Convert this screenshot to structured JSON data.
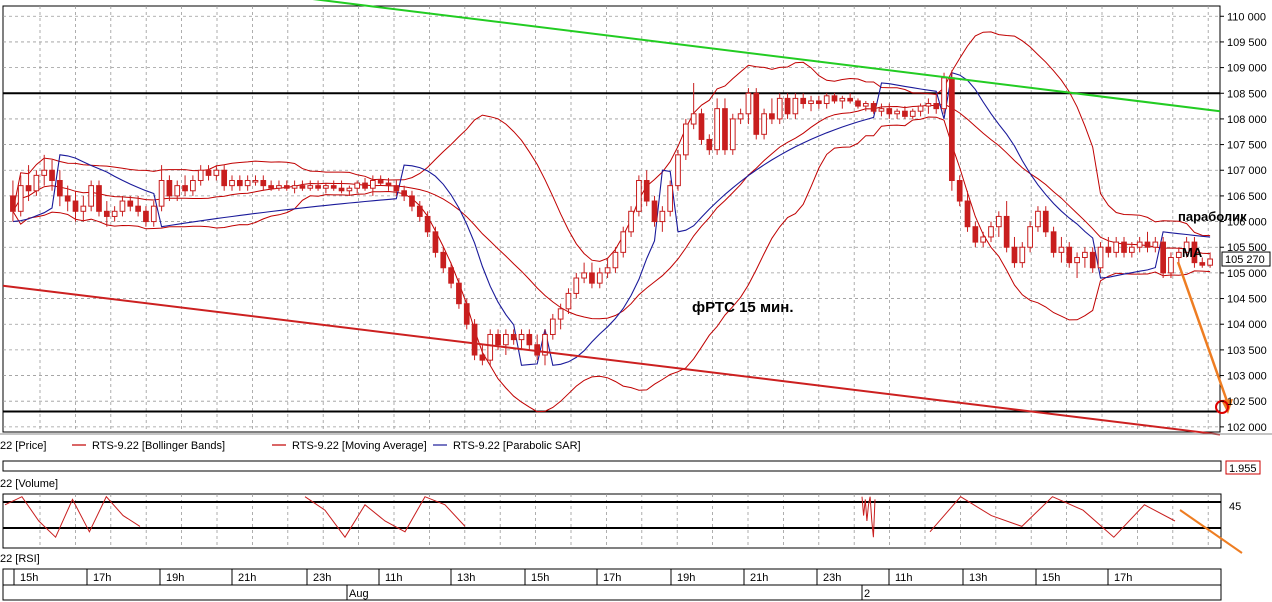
{
  "chart_data": {
    "type": "candlestick",
    "title": "фРТС   15 мин.",
    "price_axis": {
      "ylim": [
        101900,
        110200
      ],
      "ticks": [
        "110 000",
        "109 500",
        "109 000",
        "108 500",
        "108 000",
        "107 500",
        "107 000",
        "106 500",
        "106 000",
        "105 500",
        "105 000",
        "104 500",
        "104 000",
        "103 500",
        "103 000",
        "102 500",
        "102 000"
      ],
      "tick_values": [
        110000,
        109500,
        109000,
        108500,
        108000,
        107500,
        107000,
        106500,
        106000,
        105500,
        105000,
        104500,
        104000,
        103500,
        103000,
        102500,
        102000
      ],
      "last_price_label": "105 270",
      "last_price": 105270
    },
    "legend": [
      {
        "text": "22 [Price]",
        "color": "#000000"
      },
      {
        "text": "RTS-9.22 [Bollinger Bands]",
        "color": "#c00000"
      },
      {
        "text": "RTS-9.22 [Moving Average]",
        "color": "#c00000"
      },
      {
        "text": "RTS-9.22 [Parabolic SAR]",
        "color": "#1a1a9a"
      }
    ],
    "volume_panel": {
      "label": "22 [Volume]",
      "value_label": "1.955"
    },
    "rsi_panel": {
      "label": "22 [RSI]",
      "level_label": "45"
    },
    "time_axis": {
      "ticks": [
        "15h",
        "17h",
        "19h",
        "21h",
        "23h",
        "11h",
        "13h",
        "15h",
        "17h",
        "19h",
        "21h",
        "23h",
        "11h",
        "13h",
        "15h",
        "17h"
      ],
      "dates": [
        "Aug",
        "2"
      ]
    },
    "annotations": {
      "sar": "параболик",
      "ma": "MA"
    },
    "horizontal_levels": [
      108500,
      102300
    ],
    "trendlines": [
      {
        "name": "upper",
        "color": "#22cc22",
        "from": [
          0,
          110350
        ],
        "to": [
          200,
          108150
        ]
      },
      {
        "name": "lower",
        "color": "#cc2020",
        "from": [
          0,
          104750
        ],
        "to": [
          200,
          101850
        ]
      }
    ],
    "ohlc": [
      [
        106500,
        106800,
        106000,
        106200
      ],
      [
        106200,
        106900,
        106100,
        106700
      ],
      [
        106700,
        107100,
        106400,
        106600
      ],
      [
        106600,
        107000,
        106500,
        106900
      ],
      [
        106900,
        107300,
        106700,
        107000
      ],
      [
        107000,
        107200,
        106600,
        106800
      ],
      [
        106800,
        107000,
        106300,
        106500
      ],
      [
        106500,
        106700,
        106200,
        106400
      ],
      [
        106400,
        106600,
        106000,
        106200
      ],
      [
        106200,
        106500,
        106000,
        106300
      ],
      [
        106300,
        106800,
        106200,
        106700
      ],
      [
        106700,
        106800,
        106100,
        106200
      ],
      [
        106200,
        106400,
        105900,
        106100
      ],
      [
        106100,
        106300,
        106000,
        106200
      ],
      [
        106200,
        106500,
        106100,
        106400
      ],
      [
        106400,
        106500,
        106200,
        106300
      ],
      [
        106300,
        106500,
        106100,
        106200
      ],
      [
        106200,
        106300,
        105900,
        106000
      ],
      [
        106000,
        106400,
        105900,
        106300
      ],
      [
        106300,
        107100,
        106200,
        106800
      ],
      [
        106800,
        106900,
        106400,
        106500
      ],
      [
        106500,
        106800,
        106400,
        106700
      ],
      [
        106700,
        106900,
        106500,
        106600
      ],
      [
        106600,
        106900,
        106500,
        106800
      ],
      [
        106800,
        107100,
        106700,
        107000
      ],
      [
        107000,
        107100,
        106800,
        106900
      ],
      [
        106900,
        107100,
        106800,
        107000
      ],
      [
        107000,
        107100,
        106600,
        106700
      ],
      [
        106700,
        106900,
        106600,
        106800
      ],
      [
        106800,
        106900,
        106600,
        106700
      ],
      [
        106700,
        106900,
        106600,
        106800
      ],
      [
        106800,
        106900,
        106700,
        106800
      ],
      [
        106800,
        106900,
        106600,
        106700
      ],
      [
        106700,
        106800,
        106600,
        106650
      ],
      [
        106650,
        106800,
        106600,
        106700
      ],
      [
        106700,
        106800,
        106600,
        106650
      ],
      [
        106650,
        106800,
        106550,
        106700
      ],
      [
        106700,
        106800,
        106600,
        106650
      ],
      [
        106650,
        106800,
        106600,
        106700
      ],
      [
        106700,
        106800,
        106600,
        106650
      ],
      [
        106650,
        106750,
        106550,
        106700
      ],
      [
        106700,
        106800,
        106600,
        106650
      ],
      [
        106650,
        106800,
        106550,
        106600
      ],
      [
        106600,
        106700,
        106500,
        106650
      ],
      [
        106650,
        106800,
        106550,
        106750
      ],
      [
        106750,
        106850,
        106600,
        106650
      ],
      [
        106650,
        106900,
        106500,
        106800
      ],
      [
        106800,
        106900,
        106700,
        106750
      ],
      [
        106750,
        106850,
        106600,
        106700
      ],
      [
        106700,
        106800,
        106500,
        106600
      ],
      [
        106600,
        106700,
        106400,
        106500
      ],
      [
        106500,
        106600,
        106200,
        106300
      ],
      [
        106300,
        106400,
        106000,
        106100
      ],
      [
        106100,
        106200,
        105700,
        105800
      ],
      [
        105800,
        105900,
        105300,
        105400
      ],
      [
        105400,
        105500,
        105000,
        105100
      ],
      [
        105100,
        105200,
        104700,
        104800
      ],
      [
        104800,
        104900,
        104300,
        104400
      ],
      [
        104400,
        104500,
        103900,
        104000
      ],
      [
        104000,
        104100,
        103300,
        103400
      ],
      [
        103400,
        103600,
        103200,
        103300
      ],
      [
        103300,
        103900,
        103200,
        103800
      ],
      [
        103800,
        103900,
        103500,
        103600
      ],
      [
        103600,
        103900,
        103400,
        103800
      ],
      [
        103800,
        103900,
        103600,
        103700
      ],
      [
        103700,
        103900,
        103500,
        103800
      ],
      [
        103800,
        103900,
        103500,
        103600
      ],
      [
        103600,
        103800,
        103300,
        103400
      ],
      [
        103400,
        103900,
        103200,
        103800
      ],
      [
        103800,
        104200,
        103700,
        104100
      ],
      [
        104100,
        104400,
        103900,
        104300
      ],
      [
        104300,
        104700,
        104200,
        104600
      ],
      [
        104600,
        105000,
        104500,
        104900
      ],
      [
        104900,
        105200,
        104800,
        105000
      ],
      [
        105000,
        105200,
        104700,
        104800
      ],
      [
        104800,
        105100,
        104700,
        105000
      ],
      [
        105000,
        105300,
        104900,
        105100
      ],
      [
        105100,
        105500,
        105000,
        105400
      ],
      [
        105400,
        105900,
        105300,
        105800
      ],
      [
        105800,
        106300,
        105700,
        106200
      ],
      [
        106200,
        106900,
        106100,
        106800
      ],
      [
        106800,
        107000,
        106300,
        106400
      ],
      [
        106400,
        106500,
        105900,
        106000
      ],
      [
        106000,
        106300,
        105800,
        106200
      ],
      [
        106200,
        106800,
        106100,
        106700
      ],
      [
        106700,
        107400,
        106600,
        107300
      ],
      [
        107300,
        108000,
        107200,
        107900
      ],
      [
        107900,
        108700,
        107800,
        108100
      ],
      [
        108100,
        108200,
        107500,
        107600
      ],
      [
        107600,
        107700,
        107300,
        107400
      ],
      [
        107400,
        108400,
        107300,
        108200
      ],
      [
        108200,
        108400,
        107300,
        107400
      ],
      [
        107400,
        108100,
        107300,
        108000
      ],
      [
        108000,
        108200,
        107900,
        108100
      ],
      [
        108100,
        108600,
        107900,
        108500
      ],
      [
        108500,
        108600,
        107600,
        107700
      ],
      [
        107700,
        108200,
        107600,
        108100
      ],
      [
        108100,
        108400,
        107900,
        108000
      ],
      [
        108000,
        108500,
        107900,
        108400
      ],
      [
        108400,
        108500,
        108000,
        108100
      ],
      [
        108100,
        108500,
        108000,
        108400
      ],
      [
        108400,
        108500,
        108200,
        108300
      ],
      [
        108300,
        108450,
        108150,
        108350
      ],
      [
        108350,
        108450,
        108200,
        108300
      ],
      [
        108300,
        108500,
        108200,
        108450
      ],
      [
        108450,
        108500,
        108300,
        108350
      ],
      [
        108350,
        108450,
        108200,
        108400
      ],
      [
        108400,
        108500,
        108300,
        108350
      ],
      [
        108350,
        108400,
        108200,
        108250
      ],
      [
        108250,
        108350,
        108150,
        108300
      ],
      [
        108300,
        108350,
        108100,
        108150
      ],
      [
        108150,
        108300,
        108050,
        108200
      ],
      [
        108200,
        108300,
        108000,
        108100
      ],
      [
        108100,
        108200,
        108000,
        108150
      ],
      [
        108150,
        108250,
        108000,
        108050
      ],
      [
        108050,
        108200,
        108000,
        108150
      ],
      [
        108150,
        108300,
        108050,
        108250
      ],
      [
        108250,
        108400,
        108100,
        108300
      ],
      [
        108300,
        108500,
        108100,
        108200
      ],
      [
        108200,
        108900,
        108100,
        108800
      ],
      [
        108800,
        108950,
        106600,
        106800
      ],
      [
        106800,
        106900,
        106300,
        106400
      ],
      [
        106400,
        106600,
        105800,
        105900
      ],
      [
        105900,
        106000,
        105500,
        105600
      ],
      [
        105600,
        105800,
        105500,
        105700
      ],
      [
        105700,
        106000,
        105600,
        105900
      ],
      [
        105900,
        106200,
        105700,
        106100
      ],
      [
        106100,
        106400,
        105400,
        105500
      ],
      [
        105500,
        105700,
        105100,
        105200
      ],
      [
        105200,
        105600,
        105100,
        105500
      ],
      [
        105500,
        106000,
        105400,
        105900
      ],
      [
        105900,
        106300,
        105800,
        106200
      ],
      [
        106200,
        106300,
        105700,
        105800
      ],
      [
        105800,
        105900,
        105300,
        105400
      ],
      [
        105400,
        105700,
        105200,
        105500
      ],
      [
        105500,
        105600,
        105100,
        105200
      ],
      [
        105200,
        105400,
        104900,
        105300
      ],
      [
        105300,
        105500,
        105100,
        105400
      ],
      [
        105400,
        105500,
        105000,
        105100
      ],
      [
        105100,
        105600,
        105000,
        105500
      ],
      [
        105500,
        105700,
        105300,
        105400
      ],
      [
        105400,
        105700,
        105300,
        105600
      ],
      [
        105600,
        105700,
        105300,
        105400
      ],
      [
        105400,
        105600,
        105300,
        105500
      ],
      [
        105500,
        105700,
        105400,
        105600
      ],
      [
        105600,
        105800,
        105400,
        105500
      ],
      [
        105500,
        105700,
        105400,
        105600
      ],
      [
        105600,
        105700,
        104900,
        105000
      ],
      [
        105000,
        105400,
        104900,
        105300
      ],
      [
        105300,
        105500,
        105200,
        105400
      ],
      [
        105400,
        105700,
        105300,
        105600
      ],
      [
        105600,
        105700,
        105100,
        105200
      ],
      [
        105200,
        105300,
        105100,
        105150
      ],
      [
        105150,
        105400,
        105100,
        105270
      ]
    ],
    "volume_line": [
      0.62,
      0.95,
      0.7,
      0.95,
      0.95,
      0.4,
      0.2,
      0.95,
      0.3,
      0.95,
      0.95,
      0.95,
      0.6,
      0.1,
      0.5,
      0.95,
      0.9,
      0.95,
      0.2,
      0.85,
      0.4,
      0.8
    ],
    "rsi_line": [
      0.8,
      0.95,
      0.5,
      0.2,
      0.9,
      0.3,
      0.95,
      0.6,
      0.4,
      0.95,
      0.7,
      0.2,
      0.8,
      0.5,
      0.3,
      0.95,
      0.8,
      0.4,
      0.95,
      0.6,
      0.9,
      0.5
    ],
    "colors": {
      "candle": "#c81e1e",
      "bollinger": "#c00000",
      "sar": "#1a1a9a",
      "level": "#000000",
      "grid": "#9a9a9a",
      "arrow": "#ee7d22",
      "rsi": "#c81e1e"
    }
  }
}
